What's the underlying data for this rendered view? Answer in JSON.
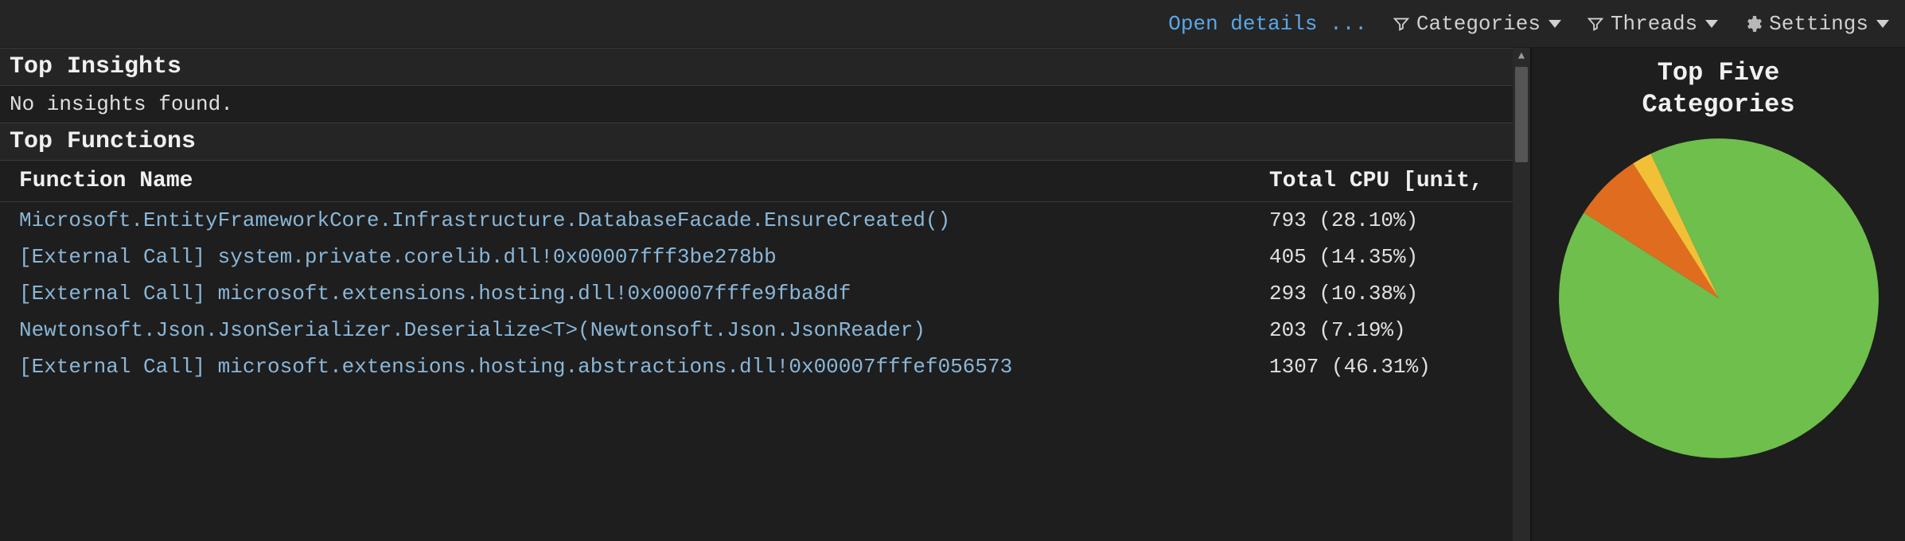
{
  "toolbar": {
    "open_details": "Open details ...",
    "categories_label": "Categories",
    "threads_label": "Threads",
    "settings_label": "Settings"
  },
  "sections": {
    "top_insights_header": "Top Insights",
    "top_insights_body": "No insights found.",
    "top_functions_header": "Top Functions"
  },
  "table": {
    "headers": {
      "function_name": "Function Name",
      "total_cpu": "Total CPU [unit,"
    },
    "rows": [
      {
        "fn": "Microsoft.EntityFrameworkCore.Infrastructure.DatabaseFacade.EnsureCreated()",
        "cpu": "793 (28.10%)"
      },
      {
        "fn": "[External Call] system.private.corelib.dll!0x00007fff3be278bb",
        "cpu": "405 (14.35%)"
      },
      {
        "fn": "[External Call] microsoft.extensions.hosting.dll!0x00007fffe9fba8df",
        "cpu": "293 (10.38%)"
      },
      {
        "fn": "Newtonsoft.Json.JsonSerializer.Deserialize<T>(Newtonsoft.Json.JsonReader)",
        "cpu": "203 (7.19%)"
      },
      {
        "fn": "[External Call] microsoft.extensions.hosting.abstractions.dll!0x00007fffef056573",
        "cpu": "1307 (46.31%)"
      }
    ]
  },
  "chart_data": {
    "type": "pie",
    "title": "Top Five Categories",
    "series": [
      {
        "name": "category-green",
        "value": 91,
        "color": "#6ebf4b"
      },
      {
        "name": "category-orange",
        "value": 7,
        "color": "#e06c1f"
      },
      {
        "name": "category-yellow",
        "value": 2,
        "color": "#f2c037"
      }
    ]
  }
}
